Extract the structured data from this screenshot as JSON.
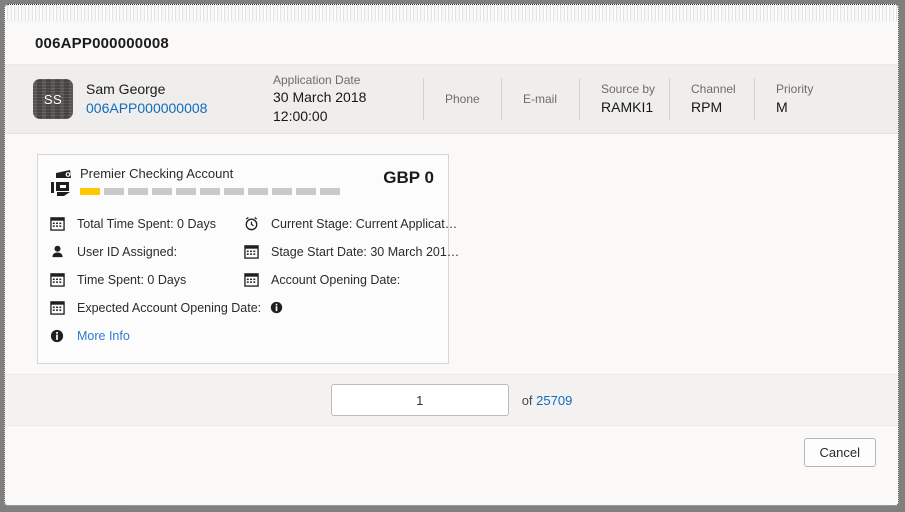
{
  "window": {
    "title": "006APP000000008"
  },
  "summary": {
    "avatar_initials": "SS",
    "person_name": "Sam George",
    "person_id": "006APP000000008",
    "fields": [
      {
        "label": "Application Date",
        "value": "30 March 2018 12:00:00"
      },
      {
        "label": "Phone",
        "value": ""
      },
      {
        "label": "E-mail",
        "value": ""
      },
      {
        "label": "Source by",
        "value": "RAMKI1"
      },
      {
        "label": "Channel",
        "value": "RPM"
      },
      {
        "label": "Priority",
        "value": "M"
      }
    ]
  },
  "card": {
    "product_name": "Premier Checking Account",
    "amount": "GBP 0",
    "progress": {
      "total_segments": 11,
      "filled_segments": 1,
      "filled_color": "#ffc800",
      "empty_color": "#c9c9c9"
    },
    "details": [
      {
        "icon": "calendar-icon",
        "text": "Total Time Spent: 0 Days"
      },
      {
        "icon": "alarm-clock-icon",
        "text": "Current Stage: Current Applicat…"
      },
      {
        "icon": "person-icon",
        "text": "User ID Assigned:"
      },
      {
        "icon": "calendar-icon",
        "text": "Stage Start Date: 30 March 201…"
      },
      {
        "icon": "calendar-icon",
        "text": "Time Spent: 0 Days"
      },
      {
        "icon": "calendar-icon",
        "text": "Account Opening Date:"
      },
      {
        "icon": "calendar-icon",
        "text": "Expected Account Opening Date:"
      }
    ],
    "more_info_label": "More Info",
    "more_info_color": "#2b7cd3"
  },
  "pager": {
    "page_value": "1",
    "page_placeholder": "",
    "of_label": "of",
    "total_pages": "25709"
  },
  "footer": {
    "cancel_label": "Cancel"
  }
}
